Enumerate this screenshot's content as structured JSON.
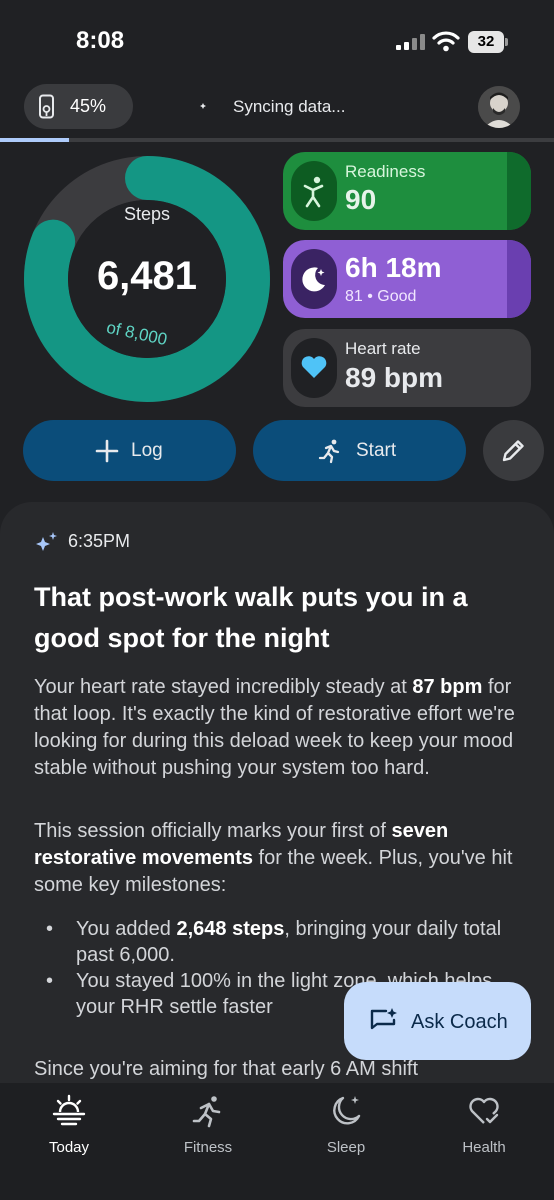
{
  "status_bar": {
    "time": "8:08",
    "battery_level": "32"
  },
  "top_row": {
    "device_battery": "45%",
    "sync_text": "Syncing data...",
    "sync_progress": 0.125
  },
  "steps": {
    "label": "Steps",
    "value": "6,481",
    "goal": "of 8,000",
    "progress": 0.81
  },
  "tiles": {
    "readiness": {
      "label": "Readiness",
      "value": "90",
      "icon": "readiness-figure-icon"
    },
    "sleep": {
      "value": "6h 18m",
      "sub": "81 • Good",
      "icon": "moon-stars-icon"
    },
    "heart_rate": {
      "label": "Heart rate",
      "value": "89 bpm",
      "icon": "heart-icon"
    }
  },
  "actions": {
    "log_label": "Log",
    "start_label": "Start",
    "edit_icon": "pencil-icon"
  },
  "coach_card": {
    "time": "6:35PM",
    "title": "That post-work walk puts you in a good spot for the night",
    "p1": {
      "t1": "Your heart rate stayed incredibly steady at ",
      "b1": "87 bpm",
      "t2": " for that loop. It's exactly the kind of restorative effort we're looking for during this deload week to keep your mood stable without pushing your system too hard."
    },
    "p2": {
      "t1": "This session officially marks your first of ",
      "b1": "seven restorative movements",
      "t2": " for the week. Plus, you've hit some key milestones:"
    },
    "bullets": [
      {
        "t1": "You added ",
        "b1": "2,648 steps",
        "t2": ", bringing your daily total past 6,000."
      },
      {
        "t1": "You stayed 100% in the light zone, which helps your RHR settle faster"
      }
    ],
    "p3": "Since you're aiming for that early 6 AM shift"
  },
  "fab": {
    "label": "Ask Coach"
  },
  "nav": [
    {
      "label": "Today",
      "icon": "sunrise-icon"
    },
    {
      "label": "Fitness",
      "icon": "runner-icon"
    },
    {
      "label": "Sleep",
      "icon": "moon-icon"
    },
    {
      "label": "Health",
      "icon": "heart-check-icon"
    }
  ],
  "colors": {
    "ring_fill": "#149684",
    "ring_track": "#3c3c3f",
    "readiness": "#1e8e3e",
    "sleep": "#8f5fd4",
    "action_button": "#0b4d7a",
    "fab": "#c6dcfb"
  }
}
